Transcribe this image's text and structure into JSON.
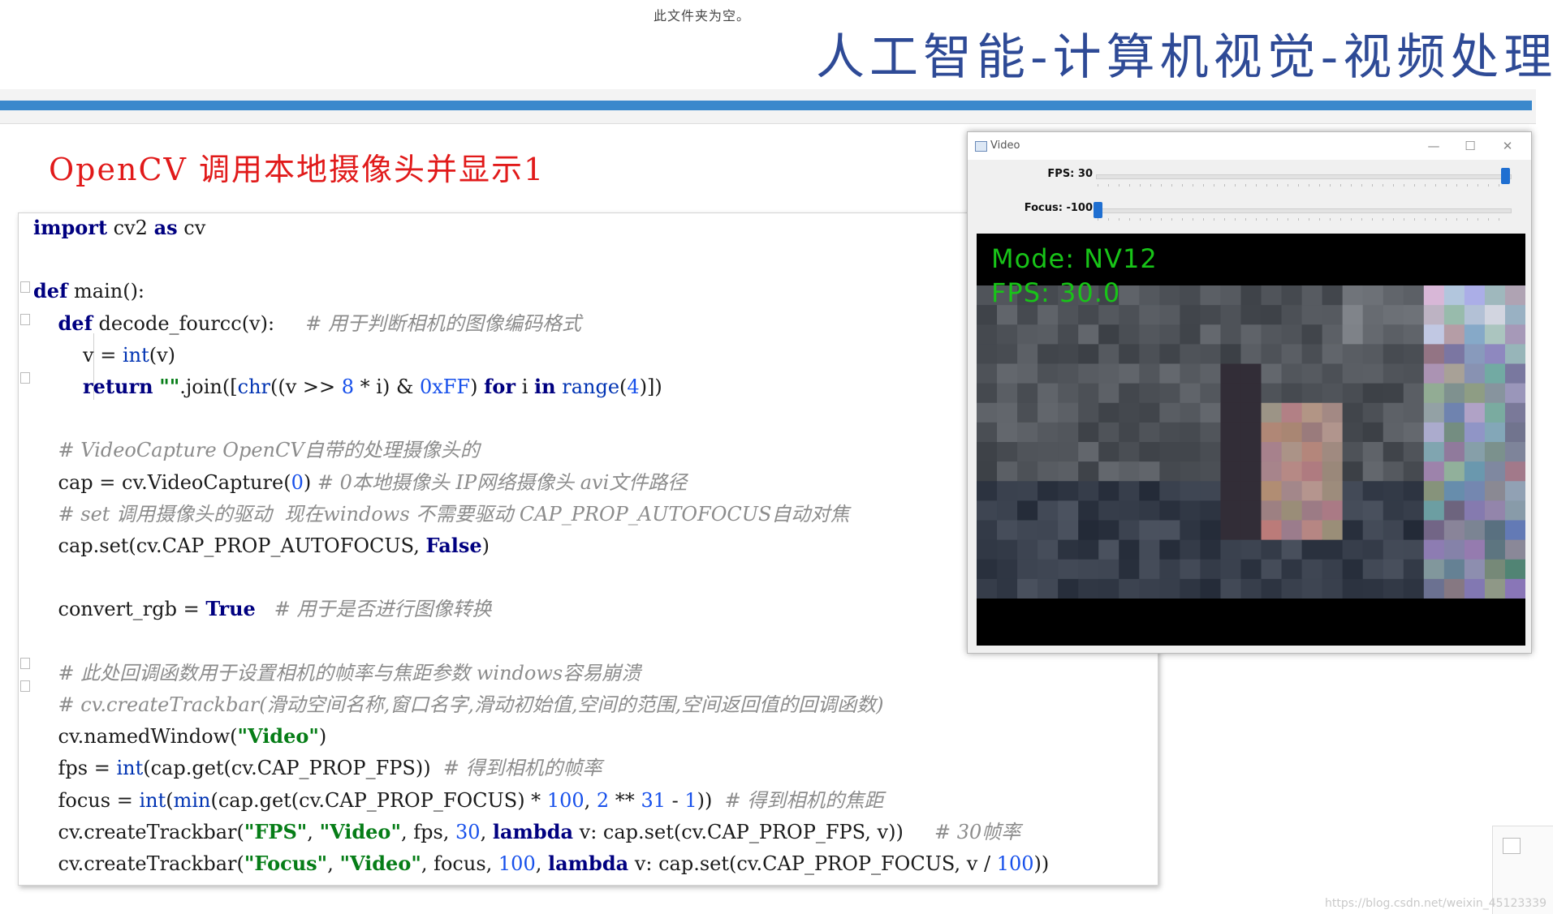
{
  "header": {
    "top_caption": "此文件夹为空。",
    "banner_title": "人工智能-计算机视觉-视频处理",
    "accent_color": "#3a88cc",
    "title_color": "#2e4a96"
  },
  "slide": {
    "title": "OpenCV 调用本地摄像头并显示1",
    "title_color": "#e11a1a"
  },
  "code": {
    "lines": [
      [
        {
          "t": "import",
          "c": "kw"
        },
        {
          "t": " cv2 "
        },
        {
          "t": "as",
          "c": "kw"
        },
        {
          "t": " cv"
        }
      ],
      [],
      [
        {
          "t": "def",
          "c": "kw"
        },
        {
          "t": " main():"
        }
      ],
      [
        {
          "t": "    "
        },
        {
          "t": "def",
          "c": "kw"
        },
        {
          "t": " decode_fourcc(v):     "
        },
        {
          "t": "# 用于判断相机的图像编码格式",
          "c": "cm"
        }
      ],
      [
        {
          "t": "        v = "
        },
        {
          "t": "int",
          "c": "bi"
        },
        {
          "t": "(v)"
        }
      ],
      [
        {
          "t": "        "
        },
        {
          "t": "return",
          "c": "kw"
        },
        {
          "t": " "
        },
        {
          "t": "\"\"",
          "c": "str"
        },
        {
          "t": ".join(["
        },
        {
          "t": "chr",
          "c": "bi"
        },
        {
          "t": "((v >> "
        },
        {
          "t": "8",
          "c": "num"
        },
        {
          "t": " * i) & "
        },
        {
          "t": "0xFF",
          "c": "num"
        },
        {
          "t": ") "
        },
        {
          "t": "for",
          "c": "kw"
        },
        {
          "t": " i "
        },
        {
          "t": "in",
          "c": "kw"
        },
        {
          "t": " "
        },
        {
          "t": "range",
          "c": "bi"
        },
        {
          "t": "("
        },
        {
          "t": "4",
          "c": "num"
        },
        {
          "t": ")])"
        }
      ],
      [],
      [
        {
          "t": "    "
        },
        {
          "t": "# VideoCapture OpenCV自带的处理摄像头的",
          "c": "cm"
        }
      ],
      [
        {
          "t": "    cap = cv.VideoCapture("
        },
        {
          "t": "0",
          "c": "num"
        },
        {
          "t": ") "
        },
        {
          "t": "# 0本地摄像头 IP网络摄像头 avi文件路径",
          "c": "cm"
        }
      ],
      [
        {
          "t": "    "
        },
        {
          "t": "# set 调用摄像头的驱动  现在windows 不需要驱动 CAP_PROP_AUTOFOCUS自动对焦",
          "c": "cm"
        }
      ],
      [
        {
          "t": "    cap.set(cv.CAP_PROP_AUTOFOCUS, "
        },
        {
          "t": "False",
          "c": "kw"
        },
        {
          "t": ")"
        }
      ],
      [],
      [
        {
          "t": "    convert_rgb = "
        },
        {
          "t": "True",
          "c": "kw"
        },
        {
          "t": "   "
        },
        {
          "t": "# 用于是否进行图像转换",
          "c": "cm"
        }
      ],
      [],
      [
        {
          "t": "    "
        },
        {
          "t": "# 此处回调函数用于设置相机的帧率与焦距参数 windows容易崩溃",
          "c": "cm"
        }
      ],
      [
        {
          "t": "    "
        },
        {
          "t": "# cv.createTrackbar(滑动空间名称,窗口名字,滑动初始值,空间的范围,空间返回值的回调函数)",
          "c": "cm"
        }
      ],
      [
        {
          "t": "    cv.namedWindow("
        },
        {
          "t": "\"Video\"",
          "c": "str"
        },
        {
          "t": ")"
        }
      ],
      [
        {
          "t": "    fps = "
        },
        {
          "t": "int",
          "c": "bi"
        },
        {
          "t": "(cap.get(cv.CAP_PROP_FPS))  "
        },
        {
          "t": "# 得到相机的帧率",
          "c": "cm"
        }
      ],
      [
        {
          "t": "    focus = "
        },
        {
          "t": "int",
          "c": "bi"
        },
        {
          "t": "("
        },
        {
          "t": "min",
          "c": "bi"
        },
        {
          "t": "(cap.get(cv.CAP_PROP_FOCUS) * "
        },
        {
          "t": "100",
          "c": "num"
        },
        {
          "t": ", "
        },
        {
          "t": "2",
          "c": "num"
        },
        {
          "t": " ** "
        },
        {
          "t": "31",
          "c": "num"
        },
        {
          "t": " - "
        },
        {
          "t": "1",
          "c": "num"
        },
        {
          "t": "))  "
        },
        {
          "t": "# 得到相机的焦距",
          "c": "cm"
        }
      ],
      [
        {
          "t": "    cv.createTrackbar("
        },
        {
          "t": "\"FPS\"",
          "c": "str"
        },
        {
          "t": ", "
        },
        {
          "t": "\"Video\"",
          "c": "str"
        },
        {
          "t": ", fps, "
        },
        {
          "t": "30",
          "c": "num"
        },
        {
          "t": ", "
        },
        {
          "t": "lambda",
          "c": "kw"
        },
        {
          "t": " v: cap.set(cv.CAP_PROP_FPS, v))     "
        },
        {
          "t": "# 30帧率",
          "c": "cm"
        }
      ],
      [
        {
          "t": "    cv.createTrackbar("
        },
        {
          "t": "\"Focus\"",
          "c": "str"
        },
        {
          "t": ", "
        },
        {
          "t": "\"Video\"",
          "c": "str"
        },
        {
          "t": ", focus, "
        },
        {
          "t": "100",
          "c": "num"
        },
        {
          "t": ", "
        },
        {
          "t": "lambda",
          "c": "kw"
        },
        {
          "t": " v: cap.set(cv.CAP_PROP_FOCUS, v / "
        },
        {
          "t": "100",
          "c": "num"
        },
        {
          "t": "))"
        }
      ]
    ]
  },
  "video_window": {
    "title": "Video",
    "minimize_glyph": "—",
    "maximize_glyph": "☐",
    "close_glyph": "✕",
    "trackbars": [
      {
        "label": "FPS: 30",
        "fraction": 1.0
      },
      {
        "label": "Focus: -100",
        "fraction": 0.0
      }
    ],
    "overlay": {
      "mode": "Mode: NV12",
      "fps": "FPS: 30.0",
      "color": "#18c418"
    },
    "thumb_color": "#1f6fd1"
  },
  "watermark": "https://blog.csdn.net/weixin_45123339"
}
